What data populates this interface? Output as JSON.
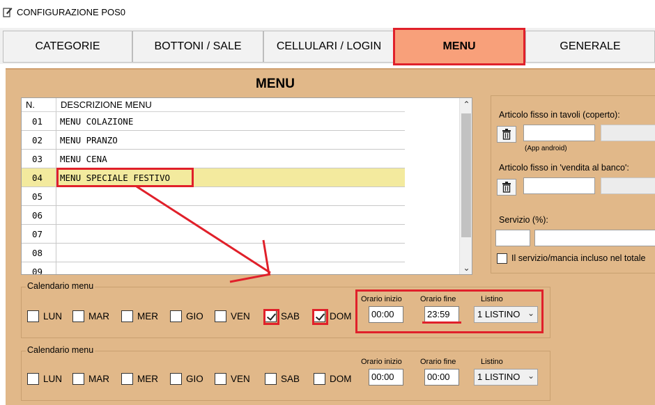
{
  "window": {
    "title": "CONFIGURAZIONE POS0"
  },
  "tabs": [
    {
      "label": "CATEGORIE"
    },
    {
      "label": "BOTTONI / SALE"
    },
    {
      "label": "CELLULARI / LOGIN"
    },
    {
      "label": "MENU",
      "active": true
    },
    {
      "label": "GENERALE"
    }
  ],
  "menu_panel": {
    "title": "MENU",
    "col_n": "N.",
    "col_desc": "DESCRIZIONE MENU",
    "rows": [
      {
        "n": "01",
        "desc": "MENU COLAZIONE"
      },
      {
        "n": "02",
        "desc": "MENU PRANZO"
      },
      {
        "n": "03",
        "desc": "MENU CENA"
      },
      {
        "n": "04",
        "desc": "MENU SPECIALE FESTIVO",
        "selected": true
      },
      {
        "n": "05",
        "desc": ""
      },
      {
        "n": "06",
        "desc": ""
      },
      {
        "n": "07",
        "desc": ""
      },
      {
        "n": "08",
        "desc": ""
      },
      {
        "n": "09",
        "desc": ""
      }
    ]
  },
  "side": {
    "coperto_label": "Articolo fisso in tavoli (coperto):",
    "app_android": "(App android)",
    "banco_label": "Articolo fisso in 'vendita al banco':",
    "servizio_label": "Servizio (%):",
    "servizio_check_label": "Il servizio/mancia incluso nel totale"
  },
  "calendars": [
    {
      "legend": "Calendario menu",
      "days": [
        {
          "label": "LUN",
          "checked": false
        },
        {
          "label": "MAR",
          "checked": false
        },
        {
          "label": "MER",
          "checked": false
        },
        {
          "label": "GIO",
          "checked": false
        },
        {
          "label": "VEN",
          "checked": false
        },
        {
          "label": "SAB",
          "checked": true
        },
        {
          "label": "DOM",
          "checked": true
        }
      ],
      "start_label": "Orario inizio",
      "end_label": "Orario fine",
      "listino_label": "Listino",
      "start": "00:00",
      "end": "23:59",
      "listino": "1 LISTINO"
    },
    {
      "legend": "Calendario menu",
      "days": [
        {
          "label": "LUN",
          "checked": false
        },
        {
          "label": "MAR",
          "checked": false
        },
        {
          "label": "MER",
          "checked": false
        },
        {
          "label": "GIO",
          "checked": false
        },
        {
          "label": "VEN",
          "checked": false
        },
        {
          "label": "SAB",
          "checked": false
        },
        {
          "label": "DOM",
          "checked": false
        }
      ],
      "start_label": "Orario inizio",
      "end_label": "Orario fine",
      "listino_label": "Listino",
      "start": "00:00",
      "end": "00:00",
      "listino": "1 LISTINO"
    }
  ],
  "colors": {
    "panel_bg": "#e1b889",
    "active_tab_bg": "#f8a07a",
    "annotation_red": "#e0202a",
    "selected_row": "#f3ea9e"
  },
  "icons": {
    "app": "app-pencil-icon",
    "delete": "trash-icon",
    "scroll_up": "chevron-up-icon",
    "scroll_down": "chevron-down-icon",
    "select": "chevron-down-icon"
  }
}
